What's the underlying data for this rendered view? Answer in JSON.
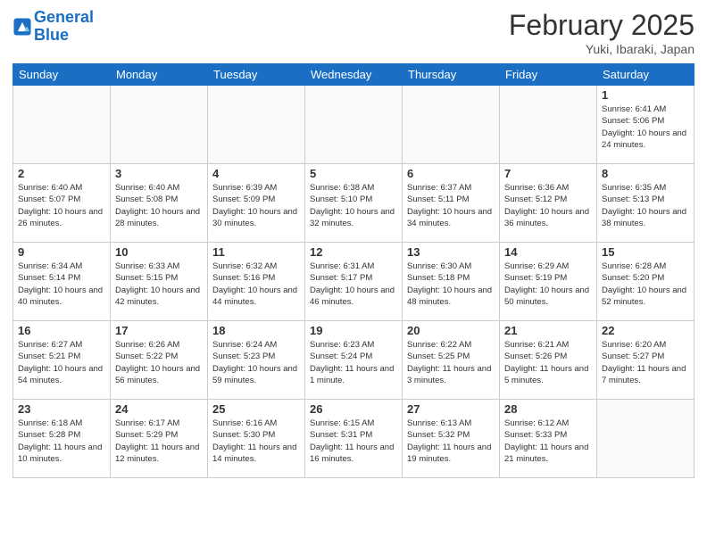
{
  "header": {
    "logo_line1": "General",
    "logo_line2": "Blue",
    "title": "February 2025",
    "subtitle": "Yuki, Ibaraki, Japan"
  },
  "weekdays": [
    "Sunday",
    "Monday",
    "Tuesday",
    "Wednesday",
    "Thursday",
    "Friday",
    "Saturday"
  ],
  "weeks": [
    [
      {
        "day": "",
        "info": ""
      },
      {
        "day": "",
        "info": ""
      },
      {
        "day": "",
        "info": ""
      },
      {
        "day": "",
        "info": ""
      },
      {
        "day": "",
        "info": ""
      },
      {
        "day": "",
        "info": ""
      },
      {
        "day": "1",
        "info": "Sunrise: 6:41 AM\nSunset: 5:06 PM\nDaylight: 10 hours and 24 minutes."
      }
    ],
    [
      {
        "day": "2",
        "info": "Sunrise: 6:40 AM\nSunset: 5:07 PM\nDaylight: 10 hours and 26 minutes."
      },
      {
        "day": "3",
        "info": "Sunrise: 6:40 AM\nSunset: 5:08 PM\nDaylight: 10 hours and 28 minutes."
      },
      {
        "day": "4",
        "info": "Sunrise: 6:39 AM\nSunset: 5:09 PM\nDaylight: 10 hours and 30 minutes."
      },
      {
        "day": "5",
        "info": "Sunrise: 6:38 AM\nSunset: 5:10 PM\nDaylight: 10 hours and 32 minutes."
      },
      {
        "day": "6",
        "info": "Sunrise: 6:37 AM\nSunset: 5:11 PM\nDaylight: 10 hours and 34 minutes."
      },
      {
        "day": "7",
        "info": "Sunrise: 6:36 AM\nSunset: 5:12 PM\nDaylight: 10 hours and 36 minutes."
      },
      {
        "day": "8",
        "info": "Sunrise: 6:35 AM\nSunset: 5:13 PM\nDaylight: 10 hours and 38 minutes."
      }
    ],
    [
      {
        "day": "9",
        "info": "Sunrise: 6:34 AM\nSunset: 5:14 PM\nDaylight: 10 hours and 40 minutes."
      },
      {
        "day": "10",
        "info": "Sunrise: 6:33 AM\nSunset: 5:15 PM\nDaylight: 10 hours and 42 minutes."
      },
      {
        "day": "11",
        "info": "Sunrise: 6:32 AM\nSunset: 5:16 PM\nDaylight: 10 hours and 44 minutes."
      },
      {
        "day": "12",
        "info": "Sunrise: 6:31 AM\nSunset: 5:17 PM\nDaylight: 10 hours and 46 minutes."
      },
      {
        "day": "13",
        "info": "Sunrise: 6:30 AM\nSunset: 5:18 PM\nDaylight: 10 hours and 48 minutes."
      },
      {
        "day": "14",
        "info": "Sunrise: 6:29 AM\nSunset: 5:19 PM\nDaylight: 10 hours and 50 minutes."
      },
      {
        "day": "15",
        "info": "Sunrise: 6:28 AM\nSunset: 5:20 PM\nDaylight: 10 hours and 52 minutes."
      }
    ],
    [
      {
        "day": "16",
        "info": "Sunrise: 6:27 AM\nSunset: 5:21 PM\nDaylight: 10 hours and 54 minutes."
      },
      {
        "day": "17",
        "info": "Sunrise: 6:26 AM\nSunset: 5:22 PM\nDaylight: 10 hours and 56 minutes."
      },
      {
        "day": "18",
        "info": "Sunrise: 6:24 AM\nSunset: 5:23 PM\nDaylight: 10 hours and 59 minutes."
      },
      {
        "day": "19",
        "info": "Sunrise: 6:23 AM\nSunset: 5:24 PM\nDaylight: 11 hours and 1 minute."
      },
      {
        "day": "20",
        "info": "Sunrise: 6:22 AM\nSunset: 5:25 PM\nDaylight: 11 hours and 3 minutes."
      },
      {
        "day": "21",
        "info": "Sunrise: 6:21 AM\nSunset: 5:26 PM\nDaylight: 11 hours and 5 minutes."
      },
      {
        "day": "22",
        "info": "Sunrise: 6:20 AM\nSunset: 5:27 PM\nDaylight: 11 hours and 7 minutes."
      }
    ],
    [
      {
        "day": "23",
        "info": "Sunrise: 6:18 AM\nSunset: 5:28 PM\nDaylight: 11 hours and 10 minutes."
      },
      {
        "day": "24",
        "info": "Sunrise: 6:17 AM\nSunset: 5:29 PM\nDaylight: 11 hours and 12 minutes."
      },
      {
        "day": "25",
        "info": "Sunrise: 6:16 AM\nSunset: 5:30 PM\nDaylight: 11 hours and 14 minutes."
      },
      {
        "day": "26",
        "info": "Sunrise: 6:15 AM\nSunset: 5:31 PM\nDaylight: 11 hours and 16 minutes."
      },
      {
        "day": "27",
        "info": "Sunrise: 6:13 AM\nSunset: 5:32 PM\nDaylight: 11 hours and 19 minutes."
      },
      {
        "day": "28",
        "info": "Sunrise: 6:12 AM\nSunset: 5:33 PM\nDaylight: 11 hours and 21 minutes."
      },
      {
        "day": "",
        "info": ""
      }
    ]
  ]
}
